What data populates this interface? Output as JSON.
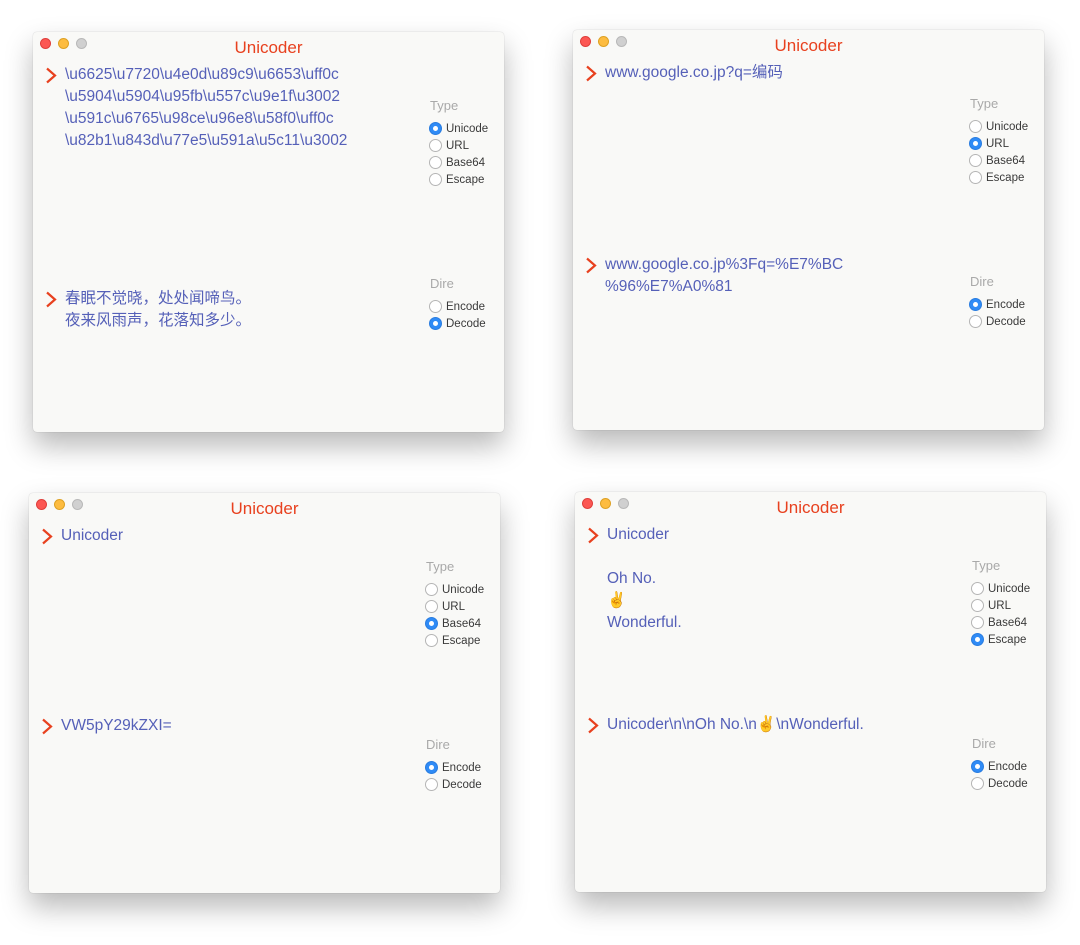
{
  "windows": [
    {
      "title": "Unicoder",
      "input_text": "\\u6625\\u7720\\u4e0d\\u89c9\\u6653\\uff0c\n\\u5904\\u5904\\u95fb\\u557c\\u9e1f\\u3002\n\\u591c\\u6765\\u98ce\\u96e8\\u58f0\\uff0c\n\\u82b1\\u843d\\u77e5\\u591a\\u5c11\\u3002",
      "output_text": "春眠不觉晓，处处闻啼鸟。\n夜来风雨声，花落知多少。",
      "type_label": "Type",
      "type_options": [
        "Unicode",
        "URL",
        "Base64",
        "Escape"
      ],
      "type_selected": "Unicode",
      "dir_label": "Dire",
      "dir_options": [
        "Encode",
        "Decode"
      ],
      "dir_selected": "Decode"
    },
    {
      "title": "Unicoder",
      "input_text": "www.google.co.jp?q=编码",
      "output_text": "www.google.co.jp%3Fq=%E7%BC\n%96%E7%A0%81",
      "type_label": "Type",
      "type_options": [
        "Unicode",
        "URL",
        "Base64",
        "Escape"
      ],
      "type_selected": "URL",
      "dir_label": "Dire",
      "dir_options": [
        "Encode",
        "Decode"
      ],
      "dir_selected": "Encode"
    },
    {
      "title": "Unicoder",
      "input_text": "Unicoder",
      "output_text": "VW5pY29kZXI=",
      "type_label": "Type",
      "type_options": [
        "Unicode",
        "URL",
        "Base64",
        "Escape"
      ],
      "type_selected": "Base64",
      "dir_label": "Dire",
      "dir_options": [
        "Encode",
        "Decode"
      ],
      "dir_selected": "Encode"
    },
    {
      "title": "Unicoder",
      "input_text": "Unicoder\n\nOh No.\n✌️\nWonderful.",
      "output_text": "Unicoder\\n\\nOh No.\\n✌️\\nWonderful.",
      "type_label": "Type",
      "type_options": [
        "Unicode",
        "URL",
        "Base64",
        "Escape"
      ],
      "type_selected": "Escape",
      "dir_label": "Dire",
      "dir_options": [
        "Encode",
        "Decode"
      ],
      "dir_selected": "Encode"
    }
  ],
  "colors": {
    "title": "#e8411f",
    "text": "#5560b8",
    "chevron": "#e8411f",
    "radio_selected": "#2f8bf6",
    "window_bg": "#f9f9f7"
  },
  "icons": {
    "chevron": "chevron-right-icon",
    "traffic_lights": [
      "close-icon",
      "minimize-icon",
      "zoom-icon"
    ]
  }
}
